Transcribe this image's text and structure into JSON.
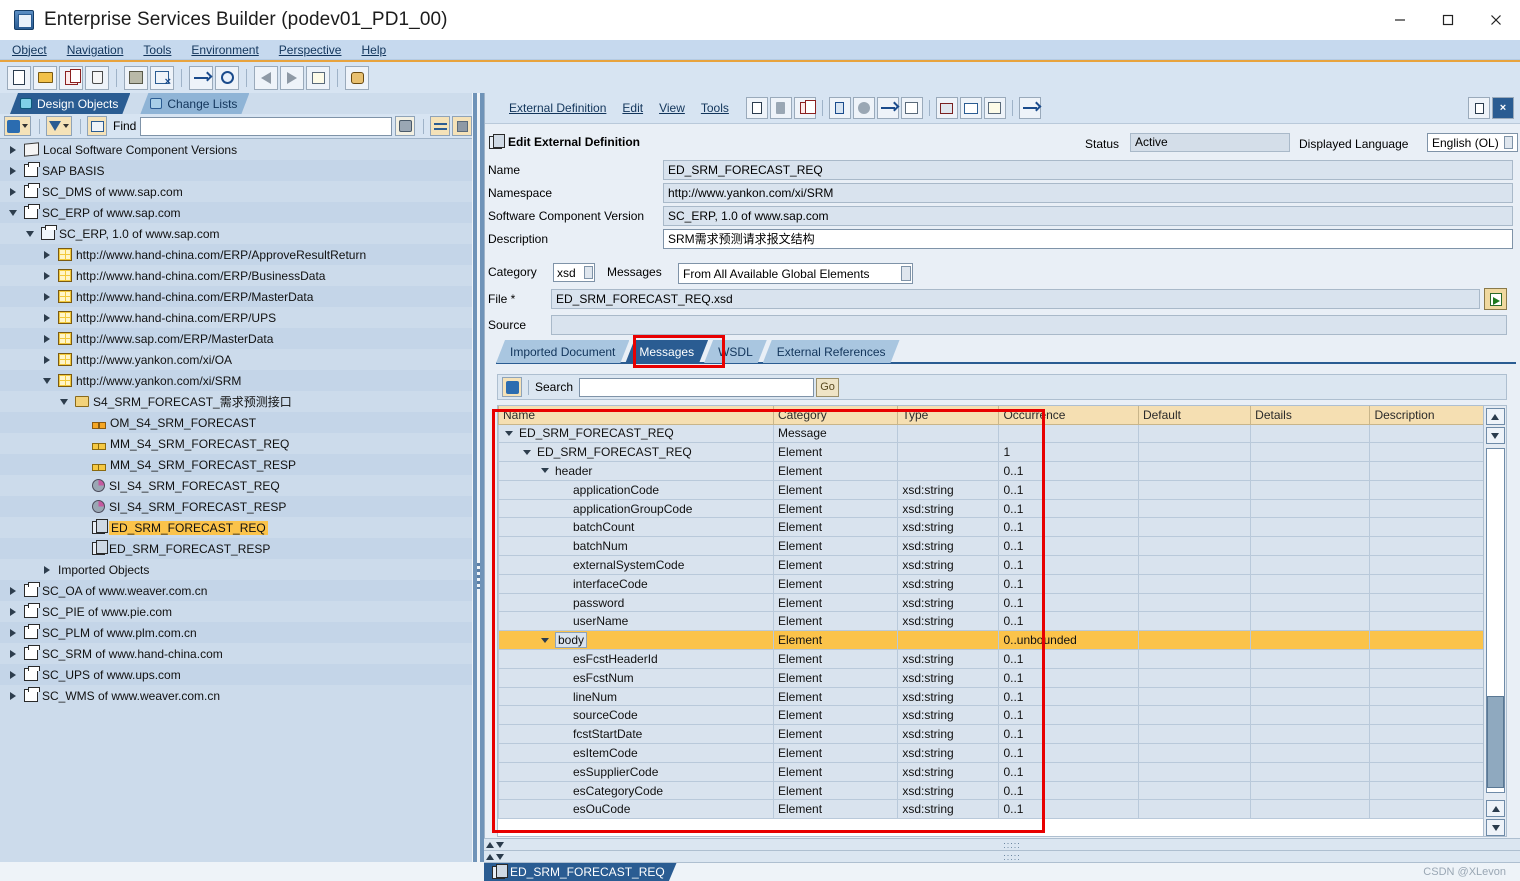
{
  "window": {
    "title": "Enterprise Services Builder (podev01_PD1_00)",
    "icon": "app-icon",
    "controls": {
      "minimize": "minimize-icon",
      "maximize": "maximize-icon",
      "close": "close-icon"
    }
  },
  "menubar": {
    "items": [
      {
        "label": "Object",
        "accel": "O"
      },
      {
        "label": "Navigation",
        "accel": "N"
      },
      {
        "label": "Tools",
        "accel": "T"
      },
      {
        "label": "Environment",
        "accel": "E"
      },
      {
        "label": "Perspective",
        "accel": "P"
      },
      {
        "label": "Help",
        "accel": "H"
      }
    ]
  },
  "toolbar": {
    "buttons": [
      "new-icon",
      "open-icon",
      "copy-icon",
      "delete-icon",
      "save-icon",
      "save-close-icon",
      "transport-icon",
      "globe-icon",
      "back-icon",
      "forward-icon",
      "list-icon",
      "palette-icon"
    ]
  },
  "sidebar": {
    "tabs": [
      {
        "label": "Design Objects",
        "icon": "design-objects-icon",
        "active": true
      },
      {
        "label": "Change Lists",
        "icon": "change-lists-icon",
        "active": false
      }
    ],
    "findbar": {
      "refresh_icon": "refresh-icon",
      "filter_icon": "filter-icon",
      "collapse_icon": "collapse-all-icon",
      "find_label": "Find",
      "find_value": "",
      "find_placeholder": "",
      "binoculars_icon": "binoculars-icon",
      "swap_icon": "swap-icon",
      "stop_icon": "stop-icon"
    },
    "tree": [
      {
        "label": "Local Software Component Versions",
        "indent": 0,
        "twist": "closed",
        "icon": "swcv-icon"
      },
      {
        "label": "SAP BASIS",
        "indent": 0,
        "twist": "closed",
        "icon": "cube-icon"
      },
      {
        "label": "SC_DMS of www.sap.com",
        "indent": 0,
        "twist": "closed",
        "icon": "cube-icon"
      },
      {
        "label": "SC_ERP of www.sap.com",
        "indent": 0,
        "twist": "open",
        "icon": "cube-icon"
      },
      {
        "label": "SC_ERP, 1.0 of www.sap.com",
        "indent": 1,
        "twist": "open",
        "icon": "cube-clock-icon"
      },
      {
        "label": "http://www.hand-china.com/ERP/ApproveResultReturn",
        "indent": 2,
        "twist": "closed",
        "icon": "namespace-icon"
      },
      {
        "label": "http://www.hand-china.com/ERP/BusinessData",
        "indent": 2,
        "twist": "closed",
        "icon": "namespace-icon"
      },
      {
        "label": "http://www.hand-china.com/ERP/MasterData",
        "indent": 2,
        "twist": "closed",
        "icon": "namespace-icon"
      },
      {
        "label": "http://www.hand-china.com/ERP/UPS",
        "indent": 2,
        "twist": "closed",
        "icon": "namespace-icon"
      },
      {
        "label": "http://www.sap.com/ERP/MasterData",
        "indent": 2,
        "twist": "closed",
        "icon": "namespace-icon"
      },
      {
        "label": "http://www.yankon.com/xi/OA",
        "indent": 2,
        "twist": "closed",
        "icon": "namespace-icon"
      },
      {
        "label": "http://www.yankon.com/xi/SRM",
        "indent": 2,
        "twist": "open",
        "icon": "namespace-icon"
      },
      {
        "label": "S4_SRM_FORECAST_需求预测接口",
        "indent": 3,
        "twist": "open",
        "icon": "folder-icon"
      },
      {
        "label": "OM_S4_SRM_FORECAST",
        "indent": 4,
        "twist": "none",
        "icon": "operation-mapping-icon"
      },
      {
        "label": "MM_S4_SRM_FORECAST_REQ",
        "indent": 4,
        "twist": "none",
        "icon": "message-mapping-icon"
      },
      {
        "label": "MM_S4_SRM_FORECAST_RESP",
        "indent": 4,
        "twist": "none",
        "icon": "message-mapping-icon"
      },
      {
        "label": "SI_S4_SRM_FORECAST_REQ",
        "indent": 4,
        "twist": "none",
        "icon": "service-interface-icon"
      },
      {
        "label": "SI_S4_SRM_FORECAST_RESP",
        "indent": 4,
        "twist": "none",
        "icon": "service-interface-icon"
      },
      {
        "label": "ED_SRM_FORECAST_REQ",
        "indent": 4,
        "twist": "none",
        "icon": "external-definition-icon",
        "selected": true
      },
      {
        "label": "ED_SRM_FORECAST_RESP",
        "indent": 4,
        "twist": "none",
        "icon": "external-definition-icon"
      },
      {
        "label": "Imported Objects",
        "indent": 2,
        "twist": "closed",
        "icon": "none"
      },
      {
        "label": "SC_OA of www.weaver.com.cn",
        "indent": 0,
        "twist": "closed",
        "icon": "cube-icon"
      },
      {
        "label": "SC_PIE of www.pie.com",
        "indent": 0,
        "twist": "closed",
        "icon": "cube-icon"
      },
      {
        "label": "SC_PLM of www.plm.com.cn",
        "indent": 0,
        "twist": "closed",
        "icon": "cube-icon"
      },
      {
        "label": "SC_SRM of www.hand-china.com",
        "indent": 0,
        "twist": "closed",
        "icon": "cube-icon"
      },
      {
        "label": "SC_UPS of www.ups.com",
        "indent": 0,
        "twist": "closed",
        "icon": "cube-icon"
      },
      {
        "label": "SC_WMS of www.weaver.com.cn",
        "indent": 0,
        "twist": "closed",
        "icon": "cube-icon"
      }
    ]
  },
  "editor": {
    "menus": [
      "External Definition",
      "Edit",
      "View",
      "Tools"
    ],
    "toolbar_icons": [
      "check-icon",
      "activate-icon",
      "copy-icon",
      "info-icon",
      "where-used-icon",
      "dependencies-icon",
      "config-icon",
      "print-icon",
      "table-icon",
      "history-icon",
      "hierarchy-icon"
    ],
    "corner_icons": [
      "pin-icon",
      "close-editor-icon"
    ],
    "header": {
      "icon": "external-definition-icon",
      "title": "Edit External Definition",
      "status_label": "Status",
      "status_value": "Active",
      "language_label": "Displayed Language",
      "language_value": "English (OL)"
    },
    "fields": [
      {
        "label": "Name",
        "value": "ED_SRM_FORECAST_REQ"
      },
      {
        "label": "Namespace",
        "value": "http://www.yankon.com/xi/SRM"
      },
      {
        "label": "Software Component Version",
        "value": "SC_ERP, 1.0 of www.sap.com"
      },
      {
        "label": "Description",
        "value": "SRM需求预测请求报文结构"
      }
    ],
    "category_label": "Category",
    "category_value": "xsd",
    "messages_label": "Messages",
    "messages_value": "From All Available Global Elements",
    "file_label": "File *",
    "file_value": "ED_SRM_FORECAST_REQ.xsd",
    "file_button_icon": "import-file-icon",
    "source_label": "Source",
    "source_value": "",
    "tabs": [
      {
        "label": "Imported Document",
        "active": false
      },
      {
        "label": "Messages",
        "active": true
      },
      {
        "label": "WSDL",
        "active": false
      },
      {
        "label": "External References",
        "active": false
      }
    ],
    "search": {
      "refresh_icon": "refresh-icon",
      "label": "Search",
      "value": "",
      "placeholder": "",
      "go_label": "Go"
    }
  },
  "table": {
    "columns": [
      "Name",
      "Category",
      "Type",
      "Occurrence",
      "Default",
      "Details",
      "Description"
    ],
    "rows": [
      {
        "name": "ED_SRM_FORECAST_REQ",
        "category": "Message",
        "type": "",
        "occurrence": "",
        "default": "",
        "details": "",
        "description": "",
        "indent": 0,
        "twist": "open",
        "highlight": false
      },
      {
        "name": "ED_SRM_FORECAST_REQ",
        "category": "Element",
        "type": "",
        "occurrence": "1",
        "default": "",
        "details": "",
        "description": "",
        "indent": 1,
        "twist": "open",
        "highlight": false
      },
      {
        "name": "header",
        "category": "Element",
        "type": "",
        "occurrence": "0..1",
        "default": "",
        "details": "",
        "description": "",
        "indent": 2,
        "twist": "open",
        "highlight": false
      },
      {
        "name": "applicationCode",
        "category": "Element",
        "type": "xsd:string",
        "occurrence": "0..1",
        "default": "",
        "details": "",
        "description": "",
        "indent": 3,
        "twist": "none",
        "highlight": false
      },
      {
        "name": "applicationGroupCode",
        "category": "Element",
        "type": "xsd:string",
        "occurrence": "0..1",
        "default": "",
        "details": "",
        "description": "",
        "indent": 3,
        "twist": "none",
        "highlight": false
      },
      {
        "name": "batchCount",
        "category": "Element",
        "type": "xsd:string",
        "occurrence": "0..1",
        "default": "",
        "details": "",
        "description": "",
        "indent": 3,
        "twist": "none",
        "highlight": false
      },
      {
        "name": "batchNum",
        "category": "Element",
        "type": "xsd:string",
        "occurrence": "0..1",
        "default": "",
        "details": "",
        "description": "",
        "indent": 3,
        "twist": "none",
        "highlight": false
      },
      {
        "name": "externalSystemCode",
        "category": "Element",
        "type": "xsd:string",
        "occurrence": "0..1",
        "default": "",
        "details": "",
        "description": "",
        "indent": 3,
        "twist": "none",
        "highlight": false
      },
      {
        "name": "interfaceCode",
        "category": "Element",
        "type": "xsd:string",
        "occurrence": "0..1",
        "default": "",
        "details": "",
        "description": "",
        "indent": 3,
        "twist": "none",
        "highlight": false
      },
      {
        "name": "password",
        "category": "Element",
        "type": "xsd:string",
        "occurrence": "0..1",
        "default": "",
        "details": "",
        "description": "",
        "indent": 3,
        "twist": "none",
        "highlight": false
      },
      {
        "name": "userName",
        "category": "Element",
        "type": "xsd:string",
        "occurrence": "0..1",
        "default": "",
        "details": "",
        "description": "",
        "indent": 3,
        "twist": "none",
        "highlight": false
      },
      {
        "name": "body",
        "category": "Element",
        "type": "",
        "occurrence": "0..unbounded",
        "default": "",
        "details": "",
        "description": "",
        "indent": 2,
        "twist": "open",
        "highlight": true
      },
      {
        "name": "esFcstHeaderId",
        "category": "Element",
        "type": "xsd:string",
        "occurrence": "0..1",
        "default": "",
        "details": "",
        "description": "",
        "indent": 3,
        "twist": "none",
        "highlight": false
      },
      {
        "name": "esFcstNum",
        "category": "Element",
        "type": "xsd:string",
        "occurrence": "0..1",
        "default": "",
        "details": "",
        "description": "",
        "indent": 3,
        "twist": "none",
        "highlight": false
      },
      {
        "name": "lineNum",
        "category": "Element",
        "type": "xsd:string",
        "occurrence": "0..1",
        "default": "",
        "details": "",
        "description": "",
        "indent": 3,
        "twist": "none",
        "highlight": false
      },
      {
        "name": "sourceCode",
        "category": "Element",
        "type": "xsd:string",
        "occurrence": "0..1",
        "default": "",
        "details": "",
        "description": "",
        "indent": 3,
        "twist": "none",
        "highlight": false
      },
      {
        "name": "fcstStartDate",
        "category": "Element",
        "type": "xsd:string",
        "occurrence": "0..1",
        "default": "",
        "details": "",
        "description": "",
        "indent": 3,
        "twist": "none",
        "highlight": false
      },
      {
        "name": "esItemCode",
        "category": "Element",
        "type": "xsd:string",
        "occurrence": "0..1",
        "default": "",
        "details": "",
        "description": "",
        "indent": 3,
        "twist": "none",
        "highlight": false
      },
      {
        "name": "esSupplierCode",
        "category": "Element",
        "type": "xsd:string",
        "occurrence": "0..1",
        "default": "",
        "details": "",
        "description": "",
        "indent": 3,
        "twist": "none",
        "highlight": false
      },
      {
        "name": "esCategoryCode",
        "category": "Element",
        "type": "xsd:string",
        "occurrence": "0..1",
        "default": "",
        "details": "",
        "description": "",
        "indent": 3,
        "twist": "none",
        "highlight": false
      },
      {
        "name": "esOuCode",
        "category": "Element",
        "type": "xsd:string",
        "occurrence": "0..1",
        "default": "",
        "details": "",
        "description": "",
        "indent": 3,
        "twist": "none",
        "highlight": false
      }
    ]
  },
  "statusbar": {
    "task_label": "ED_SRM_FORECAST_REQ",
    "task_icon": "external-definition-icon",
    "watermark": "CSDN @XLevon"
  },
  "colors": {
    "accent_blue": "#2a5c92",
    "panel_blue": "#cddcec",
    "toolbar_blue": "#d7e4f2",
    "header_tan": "#f5dfb2",
    "highlight_yellow": "#fbc34a",
    "annotation_red": "#e80000",
    "orange_rule": "#e8a33d"
  }
}
